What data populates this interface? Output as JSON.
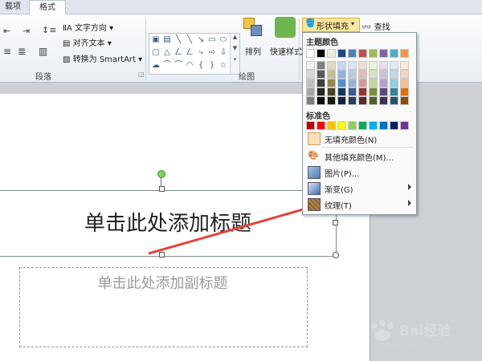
{
  "tabs": {
    "prev": "载项",
    "format": "格式"
  },
  "ribbon": {
    "paragraph_group": "段落",
    "drawing_group": "绘图",
    "text_direction": "文字方向",
    "align_text": "对齐文本",
    "convert_smartart": "转换为 SmartArt",
    "arrange_label": "排列",
    "quick_styles_label": "快速样式",
    "shape_fill_label": "形状填充",
    "find_label": "查找"
  },
  "menu": {
    "theme_colors_header": "主题颜色",
    "standard_colors_header": "标准色",
    "no_fill": "无填充颜色(N)",
    "more_fill": "其他填充颜色(M)...",
    "picture": "图片(P)...",
    "gradient": "渐变(G)",
    "texture": "纹理(T)"
  },
  "colors": {
    "theme_top": [
      "#ffffff",
      "#000000",
      "#eeece1",
      "#1f497d",
      "#4f81bd",
      "#c0504d",
      "#9bbb59",
      "#8064a2",
      "#4bacc6",
      "#f79646"
    ],
    "theme_shades": [
      [
        "#f2f2f2",
        "#7f7f7f",
        "#ddd9c3",
        "#c6d9f0",
        "#dbe5f1",
        "#f2dcdb",
        "#ebf1dd",
        "#e5e0ec",
        "#dbeef3",
        "#fdeada"
      ],
      [
        "#d8d8d8",
        "#595959",
        "#c4bd97",
        "#8db3e2",
        "#b8cce4",
        "#e5b9b7",
        "#d7e3bc",
        "#ccc1d9",
        "#b7dde8",
        "#fbd5b5"
      ],
      [
        "#bfbfbf",
        "#3f3f3f",
        "#938953",
        "#548dd4",
        "#95b3d7",
        "#d99694",
        "#c3d69b",
        "#b2a2c7",
        "#92cddc",
        "#fac08f"
      ],
      [
        "#a5a5a5",
        "#262626",
        "#494429",
        "#17365d",
        "#366092",
        "#953734",
        "#76923c",
        "#5f497a",
        "#31859b",
        "#e36c09"
      ],
      [
        "#7f7f7f",
        "#0c0c0c",
        "#1d1b10",
        "#0f243e",
        "#244061",
        "#632423",
        "#4f6128",
        "#3f3151",
        "#205867",
        "#974806"
      ]
    ],
    "standard": [
      "#c00000",
      "#ff0000",
      "#ffc000",
      "#ffff00",
      "#92d050",
      "#00b050",
      "#00b0f0",
      "#0070c0",
      "#002060",
      "#7030a0"
    ]
  },
  "slide": {
    "title_placeholder": "单击此处添加标题",
    "subtitle_placeholder": "单击此处添加副标题"
  },
  "watermark": {
    "brand": "Bai经验",
    "url": "jingyan.baidu.com"
  }
}
